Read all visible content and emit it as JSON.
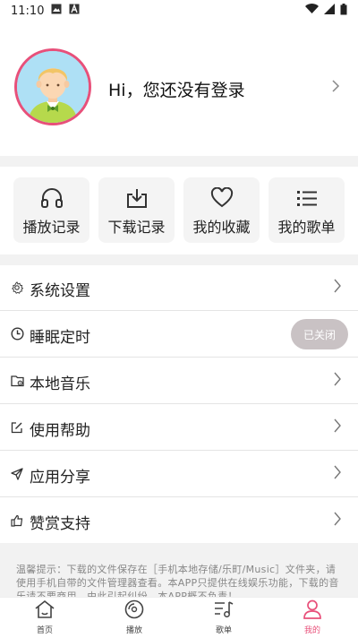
{
  "statusbar": {
    "time": "11:10"
  },
  "profile": {
    "login_text": "Hi，您还没有登录"
  },
  "quick": [
    {
      "label": "播放记录",
      "icon": "headphones-icon"
    },
    {
      "label": "下载记录",
      "icon": "download-icon"
    },
    {
      "label": "我的收藏",
      "icon": "heart-icon"
    },
    {
      "label": "我的歌单",
      "icon": "list-icon"
    }
  ],
  "settings": [
    {
      "label": "系统设置",
      "icon": "gear-icon"
    },
    {
      "label": "睡眠定时",
      "icon": "clock-icon",
      "toggle": "已关闭"
    },
    {
      "label": "本地音乐",
      "icon": "folder-music-icon"
    },
    {
      "label": "使用帮助",
      "icon": "edit-icon"
    },
    {
      "label": "应用分享",
      "icon": "send-icon"
    },
    {
      "label": "赞赏支持",
      "icon": "thumbs-up-icon"
    }
  ],
  "notice": "温馨提示：下载的文件保存在［手机本地存储/乐町/Music］文件夹，请使用手机自带的文件管理器查看。本APP只提供在线娱乐功能，下载的音乐请不要商用，由此引起纠纷，本APP概不负责！",
  "tabs": [
    {
      "label": "首页",
      "icon": "home-icon",
      "active": false
    },
    {
      "label": "播放",
      "icon": "disc-icon",
      "active": false
    },
    {
      "label": "歌单",
      "icon": "playlist-icon",
      "active": false
    },
    {
      "label": "我的",
      "icon": "user-icon",
      "active": true
    }
  ],
  "colors": {
    "accent": "#e8507a",
    "toggle_bg": "#c9c2c4",
    "separator": "#f2f2f2"
  }
}
